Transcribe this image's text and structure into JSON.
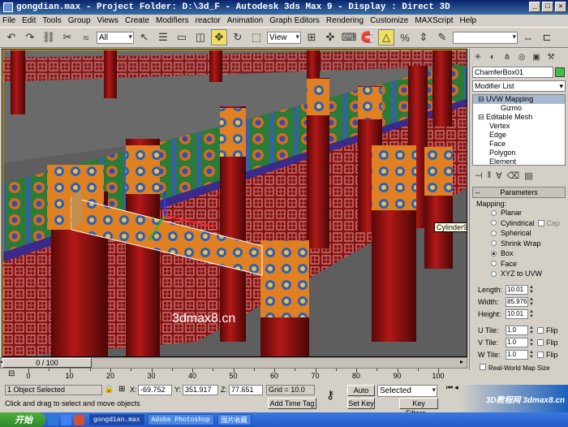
{
  "window": {
    "title": "gongdian.max  - Project Folder: D:\\3d_F  - Autodesk 3ds Max 9  - Display : Direct 3D"
  },
  "menu": [
    "File",
    "Edit",
    "Tools",
    "Group",
    "Views",
    "Create",
    "Modifiers",
    "reactor",
    "Animation",
    "Graph Editors",
    "Rendering",
    "Customize",
    "MAXScript",
    "Help"
  ],
  "toolbar": {
    "selection_filter": "All",
    "ref_coord": "View"
  },
  "viewport": {
    "tooltip": "Cylinder92",
    "watermark": "3dmax8.cn"
  },
  "panel": {
    "object_name": "ChamferBox01",
    "modifier_list": "Modifier List",
    "stack": [
      "UVW Mapping",
      "Gizmo",
      "Editable Mesh",
      "Vertex",
      "Edge",
      "Face",
      "Polygon",
      "Element"
    ],
    "rollout": "Parameters",
    "mapping_label": "Mapping:",
    "mapping_options": [
      "Planar",
      "Cylindrical",
      "Spherical",
      "Shrink Wrap",
      "Box",
      "Face",
      "XYZ to UVW"
    ],
    "cap_label": "Cap",
    "length_label": "Length:",
    "length": "10.01",
    "width_label": "Width:",
    "width": "85.976",
    "height_label": "Height:",
    "height": "10.01",
    "utile_label": "U Tile:",
    "utile": "1.0",
    "vtile_label": "V Tile:",
    "vtile": "1.0",
    "wtile_label": "W Tile:",
    "wtile": "1.0",
    "flip_label": "Flip",
    "realworld": "Real-World Map Size"
  },
  "timeline": {
    "frame": "0 / 100",
    "ticks": [
      "0",
      "10",
      "20",
      "30",
      "40",
      "50",
      "60",
      "70",
      "80",
      "90",
      "100"
    ]
  },
  "status": {
    "selected": "1 Object Selected",
    "prompt": "Click and drag to select and move objects",
    "x_label": "X:",
    "x": "-69.752",
    "y_label": "Y:",
    "y": "351.917",
    "z_label": "Z:",
    "z": "77.651",
    "grid": "Grid = 10.0",
    "add_time_tag": "Add Time Tag",
    "auto_key": "Auto Key",
    "set_key": "Set Key",
    "key_mode": "Selected",
    "key_filters": "Key Filters..."
  },
  "taskbar": {
    "start": "开始",
    "items": [
      "gongdian.max",
      "Adobe Photoshop",
      "图片收藏"
    ]
  },
  "corner_logo": "3D教程网 3dmax8.cn"
}
